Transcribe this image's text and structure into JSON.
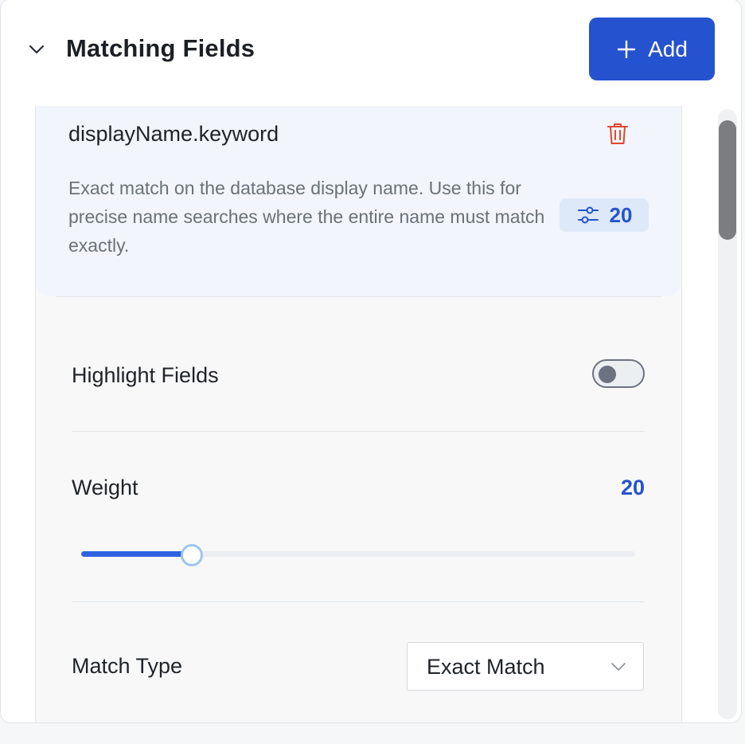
{
  "header": {
    "title": "Matching Fields",
    "add_label": "Add"
  },
  "field": {
    "name": "displayName.keyword",
    "description": "Exact match on the database display name. Use this for precise name searches where the entire name must match exactly.",
    "badge_weight": "20",
    "highlight_label": "Highlight Fields",
    "highlight_enabled": false,
    "weight_label": "Weight",
    "weight_value": "20",
    "weight_slider_fraction": 0.2,
    "match_type_label": "Match Type",
    "match_type_value": "Exact Match"
  },
  "colors": {
    "accent": "#2553cf",
    "delete": "#e0462f",
    "card_bg": "#f2f6fc"
  }
}
